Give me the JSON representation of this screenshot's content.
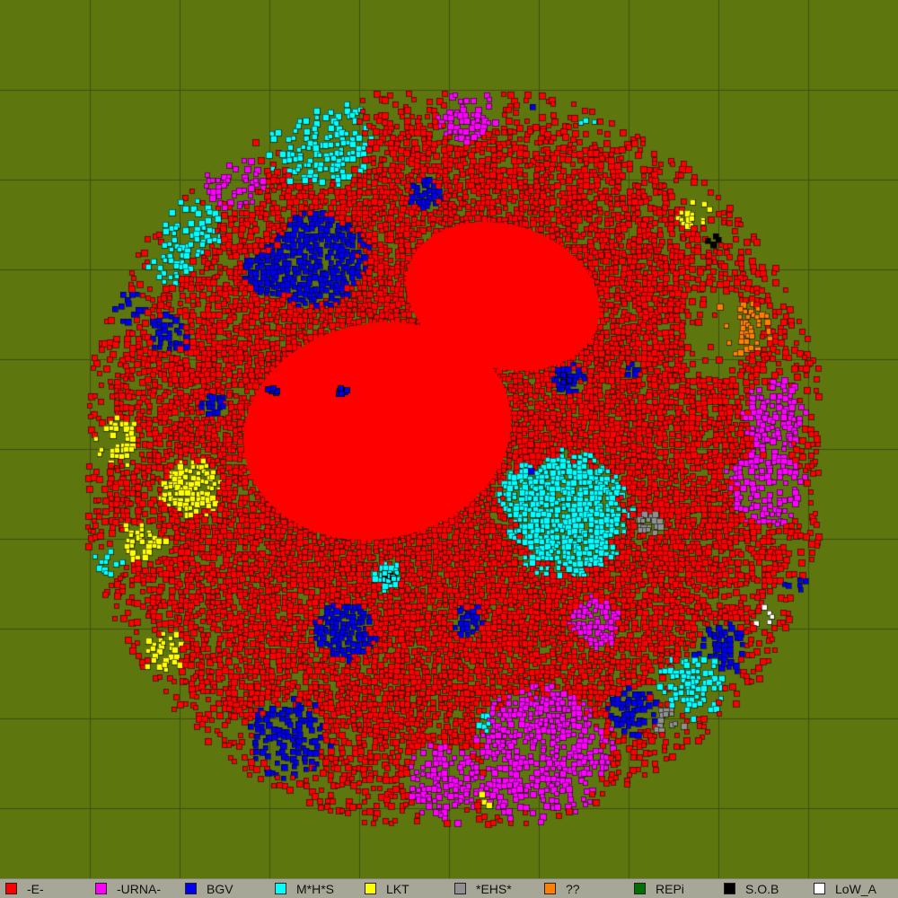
{
  "map": {
    "background_color": "#5e760e",
    "grid_line_color": "#3c5010",
    "shape": "circle"
  },
  "legend": {
    "items": [
      {
        "label": "-E-",
        "color": "#ff0000"
      },
      {
        "label": "-URNA-",
        "color": "#ff00ff"
      },
      {
        "label": "BGV",
        "color": "#0000ee"
      },
      {
        "label": "M*H*S",
        "color": "#00ffff"
      },
      {
        "label": "LKT",
        "color": "#ffff00"
      },
      {
        "label": "*EHS*",
        "color": "#909090"
      },
      {
        "label": "??",
        "color": "#ff8000"
      },
      {
        "label": "REPi",
        "color": "#007000"
      },
      {
        "label": "S.O.B",
        "color": "#000000"
      },
      {
        "label": "LoW_A",
        "color": "#ffffff"
      }
    ]
  }
}
